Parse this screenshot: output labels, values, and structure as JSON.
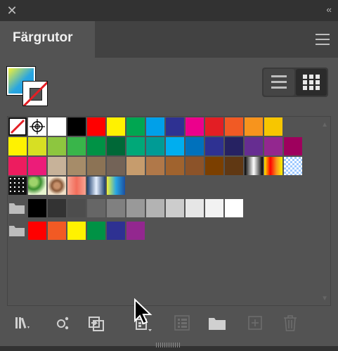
{
  "window": {
    "collapse_glyph": "‹‹",
    "close_glyph": "✕"
  },
  "tab": {
    "title": "Färgrutor"
  },
  "icons": {
    "close": "close-icon",
    "collapse": "collapse-icon",
    "panel_menu": "menu-icon",
    "list_view": "list-view-icon",
    "grid_view": "grid-view-icon",
    "folder": "folder-icon"
  },
  "colors": {
    "panel_bg": "#535353",
    "topbar_bg": "#323232"
  },
  "swatch_rows": [
    [
      "none",
      "registration",
      "#ffffff",
      "#000000",
      "#ff0000",
      "#fff200",
      "#00a651",
      "#00a0e9",
      "#2e3192",
      "#ec008c",
      "#e31e24",
      "#f15a24",
      "#f7941d",
      "#f7c600"
    ],
    [
      "#fff200",
      "#d7df23",
      "#8dc63f",
      "#39b54a",
      "#009245",
      "#006837",
      "#00a878",
      "#009b95",
      "#00aeef",
      "#0071bc",
      "#2e3192",
      "#262262",
      "#662d91",
      "#93278f",
      "#9e005d"
    ],
    [
      "#ed1c5f",
      "#ec1c79",
      "#c7b299",
      "#a68c69",
      "#8c7355",
      "#736357",
      "#c69c6d",
      "#b07849",
      "#a0632e",
      "#8c5329",
      "#7b3f00",
      "#603813",
      "grad-bw",
      "grad-spectrum",
      "grad-transp"
    ],
    [
      "pattern-dots",
      "pattern-leaves",
      "pattern-swirl",
      "grad-salmon",
      "grad-steel",
      "grad-sky"
    ],
    [
      "#000000",
      "#333333",
      "#4d4d4d",
      "#666666",
      "#808080",
      "#999999",
      "#b3b3b3",
      "#cccccc",
      "#e6e6e6",
      "#f2f2f2",
      "#ffffff"
    ],
    [
      "#ff0000",
      "#f15a24",
      "#fff200",
      "#009245",
      "#2e3192",
      "#93278f"
    ]
  ],
  "bottom_toolbar": [
    {
      "name": "swatch-libraries-icon"
    },
    {
      "name": "show-kinds-icon"
    },
    {
      "name": "place-swatches-icon"
    },
    {
      "name": "swatch-options-icon"
    },
    {
      "name": "new-color-group-icon"
    },
    {
      "name": "new-swatch-icon"
    },
    {
      "name": "delete-swatch-icon"
    }
  ]
}
